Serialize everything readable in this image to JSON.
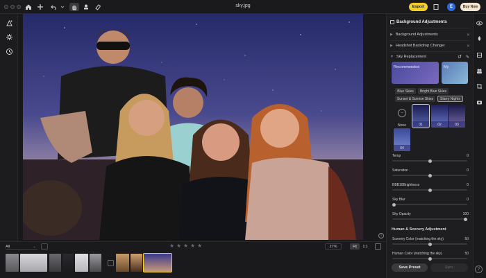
{
  "app": {
    "title": "sky.jpg",
    "export_label": "Export",
    "avatar_initial": "E",
    "buy_now_label": "Buy Now"
  },
  "panel": {
    "header": "Background Adjustments",
    "rows": [
      {
        "label": "Background Adjustments"
      },
      {
        "label": "Headshot Backdrop Changer"
      },
      {
        "label": "Sky Replacement"
      }
    ],
    "presets": [
      {
        "label": "Recommended"
      },
      {
        "label": "My"
      }
    ],
    "chips_row1": [
      "Blue Skies",
      "Bright Blue Skies"
    ],
    "chips_row2": [
      "Sunset & Sunrise Skies",
      "Starry Nights"
    ],
    "selected_chip": "Starry Nights",
    "sky_none_label": "None",
    "sky_thumbs": [
      "01",
      "02",
      "03",
      "04"
    ],
    "sliders": [
      {
        "label": "Temp",
        "value": "0",
        "pos": 0.5
      },
      {
        "label": "Saturation",
        "value": "0",
        "pos": 0.5
      },
      {
        "label": "BBB16Brightness",
        "value": "0",
        "pos": 0.5
      },
      {
        "label": "Sky Blur",
        "value": "0",
        "pos": 0.0
      },
      {
        "label": "Sky Opacity",
        "value": "100",
        "pos": 1.0
      }
    ],
    "section_human": "Human & Scenery Adjustment",
    "sliders2": [
      {
        "label": "Scenery Color (matching the sky)",
        "value": "50",
        "pos": 0.5
      },
      {
        "label": "Human Color (matching the sky)",
        "value": "50",
        "pos": 0.5
      }
    ],
    "save_preset_label": "Save Preset",
    "sync_label": "Sync"
  },
  "filmstrip": {
    "filter_value": "All",
    "zoom_level": "27%",
    "fit_label": "Fit",
    "one_to_one_label": "1:1",
    "stars": 5
  },
  "colors": {
    "accent": "#f4d027",
    "avatar": "#2f6bd8",
    "panel_bg": "#1e1e20"
  }
}
